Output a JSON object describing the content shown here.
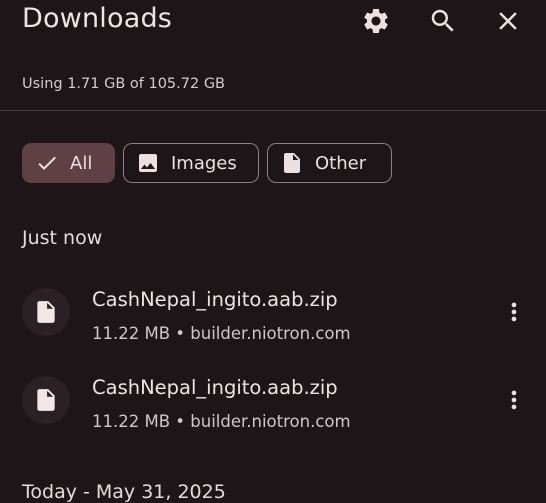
{
  "header": {
    "title": "Downloads",
    "settings_icon": "gear-icon",
    "search_icon": "search-icon",
    "close_icon": "close-icon"
  },
  "storage": {
    "text": "Using 1.71 GB of 105.72 GB"
  },
  "filters": [
    {
      "label": "All",
      "icon": "check-icon",
      "selected": true
    },
    {
      "label": "Images",
      "icon": "image-icon",
      "selected": false
    },
    {
      "label": "Other",
      "icon": "file-icon",
      "selected": false
    }
  ],
  "sections": [
    {
      "heading": "Just now",
      "items": [
        {
          "name": "CashNepal_ingito.aab.zip",
          "size": "11.22 MB",
          "separator": "•",
          "source": "builder.niotron.com",
          "icon": "file-icon"
        },
        {
          "name": "CashNepal_ingito.aab.zip",
          "size": "11.22 MB",
          "separator": "•",
          "source": "builder.niotron.com",
          "icon": "file-icon"
        }
      ]
    },
    {
      "heading": "Today - May 31, 2025",
      "items": []
    }
  ],
  "colors": {
    "background": "#1d1517",
    "selected_chip": "#5e4045",
    "chip_border": "#8e7f82",
    "text": "#ece0e1"
  }
}
